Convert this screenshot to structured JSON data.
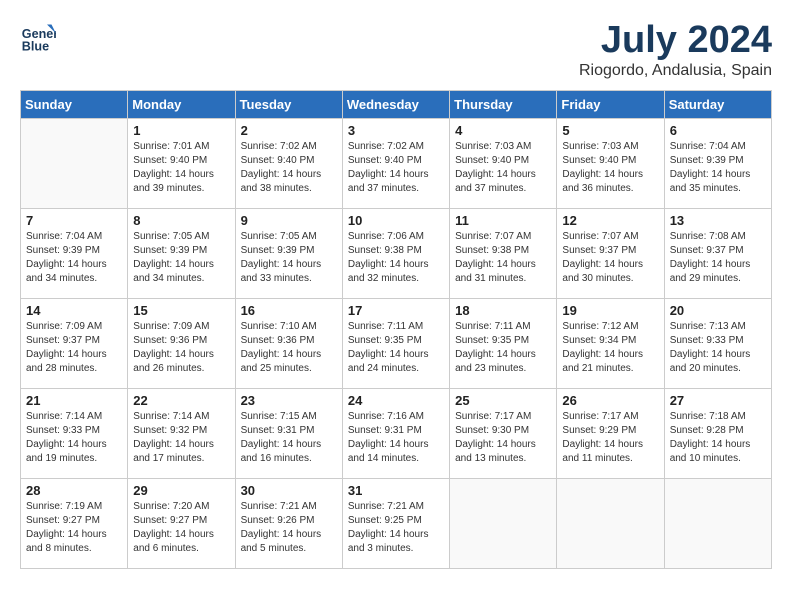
{
  "header": {
    "logo_line1": "General",
    "logo_line2": "Blue",
    "month_year": "July 2024",
    "location": "Riogordo, Andalusia, Spain"
  },
  "weekdays": [
    "Sunday",
    "Monday",
    "Tuesday",
    "Wednesday",
    "Thursday",
    "Friday",
    "Saturday"
  ],
  "weeks": [
    [
      {
        "day": "",
        "info": ""
      },
      {
        "day": "1",
        "info": "Sunrise: 7:01 AM\nSunset: 9:40 PM\nDaylight: 14 hours\nand 39 minutes."
      },
      {
        "day": "2",
        "info": "Sunrise: 7:02 AM\nSunset: 9:40 PM\nDaylight: 14 hours\nand 38 minutes."
      },
      {
        "day": "3",
        "info": "Sunrise: 7:02 AM\nSunset: 9:40 PM\nDaylight: 14 hours\nand 37 minutes."
      },
      {
        "day": "4",
        "info": "Sunrise: 7:03 AM\nSunset: 9:40 PM\nDaylight: 14 hours\nand 37 minutes."
      },
      {
        "day": "5",
        "info": "Sunrise: 7:03 AM\nSunset: 9:40 PM\nDaylight: 14 hours\nand 36 minutes."
      },
      {
        "day": "6",
        "info": "Sunrise: 7:04 AM\nSunset: 9:39 PM\nDaylight: 14 hours\nand 35 minutes."
      }
    ],
    [
      {
        "day": "7",
        "info": "Sunrise: 7:04 AM\nSunset: 9:39 PM\nDaylight: 14 hours\nand 34 minutes."
      },
      {
        "day": "8",
        "info": "Sunrise: 7:05 AM\nSunset: 9:39 PM\nDaylight: 14 hours\nand 34 minutes."
      },
      {
        "day": "9",
        "info": "Sunrise: 7:05 AM\nSunset: 9:39 PM\nDaylight: 14 hours\nand 33 minutes."
      },
      {
        "day": "10",
        "info": "Sunrise: 7:06 AM\nSunset: 9:38 PM\nDaylight: 14 hours\nand 32 minutes."
      },
      {
        "day": "11",
        "info": "Sunrise: 7:07 AM\nSunset: 9:38 PM\nDaylight: 14 hours\nand 31 minutes."
      },
      {
        "day": "12",
        "info": "Sunrise: 7:07 AM\nSunset: 9:37 PM\nDaylight: 14 hours\nand 30 minutes."
      },
      {
        "day": "13",
        "info": "Sunrise: 7:08 AM\nSunset: 9:37 PM\nDaylight: 14 hours\nand 29 minutes."
      }
    ],
    [
      {
        "day": "14",
        "info": "Sunrise: 7:09 AM\nSunset: 9:37 PM\nDaylight: 14 hours\nand 28 minutes."
      },
      {
        "day": "15",
        "info": "Sunrise: 7:09 AM\nSunset: 9:36 PM\nDaylight: 14 hours\nand 26 minutes."
      },
      {
        "day": "16",
        "info": "Sunrise: 7:10 AM\nSunset: 9:36 PM\nDaylight: 14 hours\nand 25 minutes."
      },
      {
        "day": "17",
        "info": "Sunrise: 7:11 AM\nSunset: 9:35 PM\nDaylight: 14 hours\nand 24 minutes."
      },
      {
        "day": "18",
        "info": "Sunrise: 7:11 AM\nSunset: 9:35 PM\nDaylight: 14 hours\nand 23 minutes."
      },
      {
        "day": "19",
        "info": "Sunrise: 7:12 AM\nSunset: 9:34 PM\nDaylight: 14 hours\nand 21 minutes."
      },
      {
        "day": "20",
        "info": "Sunrise: 7:13 AM\nSunset: 9:33 PM\nDaylight: 14 hours\nand 20 minutes."
      }
    ],
    [
      {
        "day": "21",
        "info": "Sunrise: 7:14 AM\nSunset: 9:33 PM\nDaylight: 14 hours\nand 19 minutes."
      },
      {
        "day": "22",
        "info": "Sunrise: 7:14 AM\nSunset: 9:32 PM\nDaylight: 14 hours\nand 17 minutes."
      },
      {
        "day": "23",
        "info": "Sunrise: 7:15 AM\nSunset: 9:31 PM\nDaylight: 14 hours\nand 16 minutes."
      },
      {
        "day": "24",
        "info": "Sunrise: 7:16 AM\nSunset: 9:31 PM\nDaylight: 14 hours\nand 14 minutes."
      },
      {
        "day": "25",
        "info": "Sunrise: 7:17 AM\nSunset: 9:30 PM\nDaylight: 14 hours\nand 13 minutes."
      },
      {
        "day": "26",
        "info": "Sunrise: 7:17 AM\nSunset: 9:29 PM\nDaylight: 14 hours\nand 11 minutes."
      },
      {
        "day": "27",
        "info": "Sunrise: 7:18 AM\nSunset: 9:28 PM\nDaylight: 14 hours\nand 10 minutes."
      }
    ],
    [
      {
        "day": "28",
        "info": "Sunrise: 7:19 AM\nSunset: 9:27 PM\nDaylight: 14 hours\nand 8 minutes."
      },
      {
        "day": "29",
        "info": "Sunrise: 7:20 AM\nSunset: 9:27 PM\nDaylight: 14 hours\nand 6 minutes."
      },
      {
        "day": "30",
        "info": "Sunrise: 7:21 AM\nSunset: 9:26 PM\nDaylight: 14 hours\nand 5 minutes."
      },
      {
        "day": "31",
        "info": "Sunrise: 7:21 AM\nSunset: 9:25 PM\nDaylight: 14 hours\nand 3 minutes."
      },
      {
        "day": "",
        "info": ""
      },
      {
        "day": "",
        "info": ""
      },
      {
        "day": "",
        "info": ""
      }
    ]
  ]
}
